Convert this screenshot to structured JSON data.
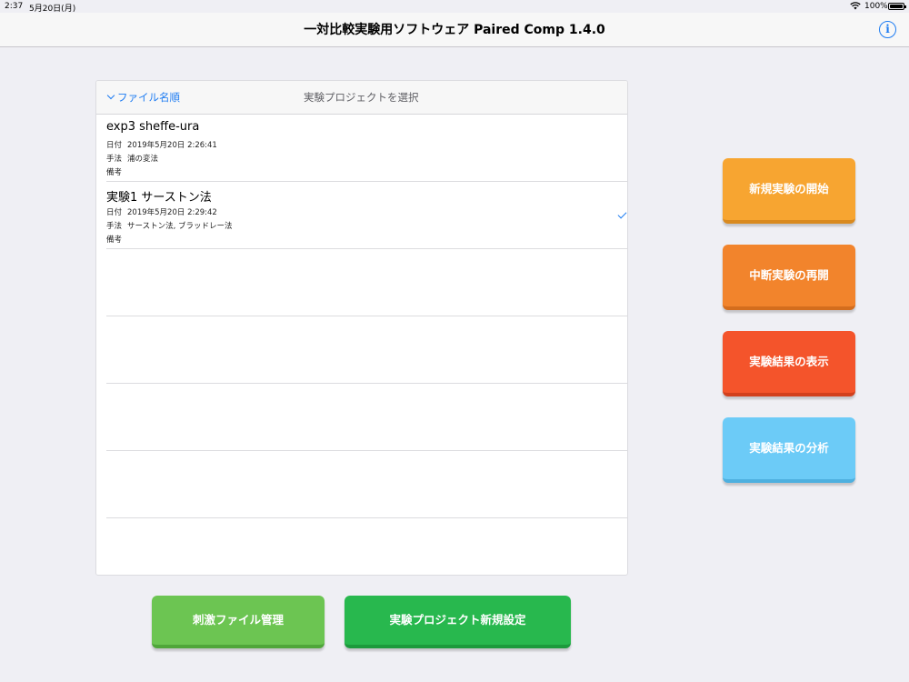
{
  "status_bar": {
    "time": "2:37",
    "date": "5月20日(月)",
    "battery_percent": "100%",
    "battery_level": 1.0
  },
  "nav": {
    "title": "一対比較実験用ソフトウェア Paired Comp 1.4.0",
    "info_icon": "info-icon",
    "info_glyph": "i"
  },
  "project_list": {
    "sort_label": "ファイル名順",
    "title": "実験プロジェクトを選択",
    "date_label": "日付",
    "method_label": "手法",
    "note_label": "備考",
    "items": [
      {
        "name": "exp3 sheffe-ura",
        "date": "2019年5月20日 2:26:41",
        "method": "浦の変法",
        "note": "",
        "selected": false
      },
      {
        "name": "実験1 サーストン法",
        "date": "2019年5月20日 2:29:42",
        "method": "サーストン法, ブラッドレー法",
        "note": "",
        "selected": true
      }
    ]
  },
  "side_buttons": {
    "new_experiment": "新規実験の開始",
    "resume_experiment": "中断実験の再開",
    "show_results": "実験結果の表示",
    "analyze_results": "実験結果の分析"
  },
  "bottom_buttons": {
    "stimulus_files": "刺激ファイル管理",
    "new_project": "実験プロジェクト新規設定"
  },
  "colors": {
    "accent": "#1e7cf2",
    "new_experiment": "#f7a531",
    "resume_experiment": "#f2842c",
    "show_results": "#f4542b",
    "analyze_results": "#6ccbf7",
    "stimulus_files": "#6cc552",
    "new_project": "#28b84e"
  }
}
